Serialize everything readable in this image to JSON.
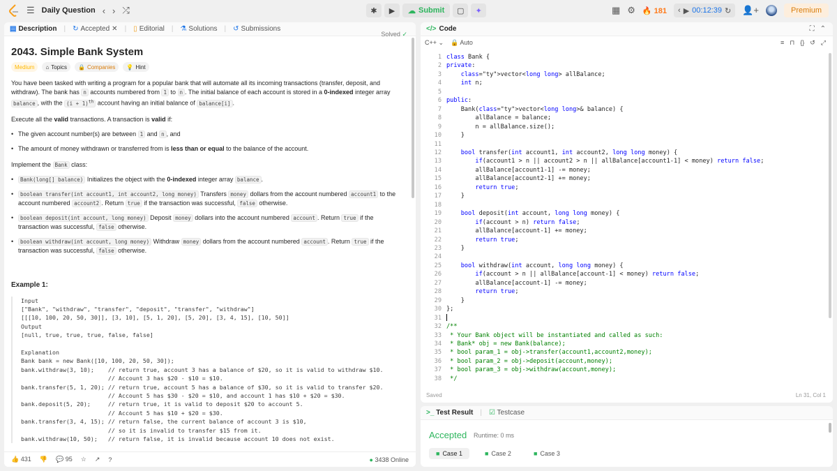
{
  "topbar": {
    "title": "Daily Question",
    "submit_label": "Submit",
    "streak": "181",
    "timer": "00:12:39",
    "premium_label": "Premium"
  },
  "left_tabs": [
    {
      "label": "Description"
    },
    {
      "label": "Accepted"
    },
    {
      "label": "Editorial"
    },
    {
      "label": "Solutions"
    },
    {
      "label": "Submissions"
    }
  ],
  "problem": {
    "title": "2043. Simple Bank System",
    "solved": "Solved",
    "tags": {
      "difficulty": "Medium",
      "topics": "Topics",
      "companies": "Companies",
      "hint": "Hint"
    },
    "p1a": "You have been tasked with writing a program for a popular bank that will automate all its incoming transactions (transfer, deposit, and withdraw). The bank has ",
    "p1_n": "n",
    "p1b": " accounts numbered from ",
    "p1_1": "1",
    "p1c": " to ",
    "p1_n2": "n",
    "p1d": ". The initial balance of each account is stored in a ",
    "p1_bold": "0-indexed",
    "p1e": " integer array ",
    "p1_balance": "balance",
    "p1f": ", with the ",
    "p1_i1": "(i + 1)",
    "p1_th": "th",
    "p1g": " account having an initial balance of ",
    "p1_bi": "balance[i]",
    "p1h": ".",
    "p2a": "Execute all the ",
    "p2_valid": "valid",
    "p2b": " transactions. A transaction is ",
    "p2_valid2": "valid",
    "p2c": " if:",
    "b1a": "The given account number(s) are between ",
    "b1_1": "1",
    "b1b": " and ",
    "b1_n": "n",
    "b1c": ", and",
    "b2a": "The amount of money withdrawn or transferred from is ",
    "b2_bold": "less than or equal",
    "b2b": " to the balance of the account.",
    "p3a": "Implement the ",
    "p3_bank": "Bank",
    "p3b": " class:",
    "m1_code": "Bank(long[] balance)",
    "m1a": " Initializes the object with the ",
    "m1_bold": "0-indexed",
    "m1b": " integer array ",
    "m1_bal": "balance",
    "m1c": ".",
    "m2_code": "boolean transfer(int account1, int account2, long money)",
    "m2a": " Transfers ",
    "m2_money": "money",
    "m2b": " dollars from the account numbered ",
    "m2_a1": "account1",
    "m2c": " to the account numbered ",
    "m2_a2": "account2",
    "m2d": ". Return ",
    "m2_true": "true",
    "m2e": " if the transaction was successful, ",
    "m2_false": "false",
    "m2f": " otherwise.",
    "m3_code": "boolean deposit(int account, long money)",
    "m3a": " Deposit ",
    "m3_money": "money",
    "m3b": " dollars into the account numbered ",
    "m3_acc": "account",
    "m3c": ". Return ",
    "m3_true": "true",
    "m3d": " if the transaction was successful, ",
    "m3_false": "false",
    "m3e": " otherwise.",
    "m4_code": "boolean withdraw(int account, long money)",
    "m4a": " Withdraw ",
    "m4_money": "money",
    "m4b": " dollars from the account numbered ",
    "m4_acc": "account",
    "m4c": ". Return ",
    "m4_true": "true",
    "m4d": " if the transaction was successful, ",
    "m4_false": "false",
    "m4e": " otherwise.",
    "example_title": "Example 1:",
    "example_body": "Input\n[\"Bank\", \"withdraw\", \"transfer\", \"deposit\", \"transfer\", \"withdraw\"]\n[[[10, 100, 20, 50, 30]], [3, 10], [5, 1, 20], [5, 20], [3, 4, 15], [10, 50]]\nOutput\n[null, true, true, true, false, false]\n\nExplanation\nBank bank = new Bank([10, 100, 20, 50, 30]);\nbank.withdraw(3, 10);    // return true, account 3 has a balance of $20, so it is valid to withdraw $10.\n                         // Account 3 has $20 - $10 = $10.\nbank.transfer(5, 1, 20); // return true, account 5 has a balance of $30, so it is valid to transfer $20.\n                         // Account 5 has $30 - $20 = $10, and account 1 has $10 + $20 = $30.\nbank.deposit(5, 20);     // return true, it is valid to deposit $20 to account 5.\n                         // Account 5 has $10 + $20 = $30.\nbank.transfer(3, 4, 15); // return false, the current balance of account 3 is $10,\n                         // so it is invalid to transfer $15 from it.\nbank.withdraw(10, 50);   // return false, it is invalid because account 10 does not exist."
  },
  "footer": {
    "likes": "431",
    "comments": "95",
    "online": "3438 Online"
  },
  "code_panel": {
    "title": "Code",
    "language": "C++",
    "auto": "Auto",
    "saved": "Saved",
    "cursor": "Ln 31, Col 1",
    "code_lines": [
      "class Bank {",
      "private:",
      "    vector<long long> allBalance;",
      "    int n;",
      "",
      "public:",
      "    Bank(vector<long long>& balance) {",
      "        allBalance = balance;",
      "        n = allBalance.size();",
      "    }",
      "",
      "    bool transfer(int account1, int account2, long long money) {",
      "        if(account1 > n || account2 > n || allBalance[account1-1] < money) return false;",
      "        allBalance[account1-1] -= money;",
      "        allBalance[account2-1] += money;",
      "        return true;",
      "    }",
      "",
      "    bool deposit(int account, long long money) {",
      "        if(account > n) return false;",
      "        allBalance[account-1] += money;",
      "        return true;",
      "    }",
      "",
      "    bool withdraw(int account, long long money) {",
      "        if(account > n || allBalance[account-1] < money) return false;",
      "        allBalance[account-1] -= money;",
      "        return true;",
      "    }",
      "};",
      "",
      "/**",
      " * Your Bank object will be instantiated and called as such:",
      " * Bank* obj = new Bank(balance);",
      " * bool param_1 = obj->transfer(account1,account2,money);",
      " * bool param_2 = obj->deposit(account,money);",
      " * bool param_3 = obj->withdraw(account,money);",
      " */"
    ]
  },
  "test_panel": {
    "tab_result": "Test Result",
    "tab_testcase": "Testcase",
    "status": "Accepted",
    "runtime": "Runtime: 0 ms",
    "cases": [
      "Case 1",
      "Case 2",
      "Case 3"
    ]
  },
  "colors": {
    "accent_green": "#2db55d",
    "keyword_blue": "#0000ff",
    "comment_green": "#008000",
    "premium_orange": "#d97d0b"
  }
}
